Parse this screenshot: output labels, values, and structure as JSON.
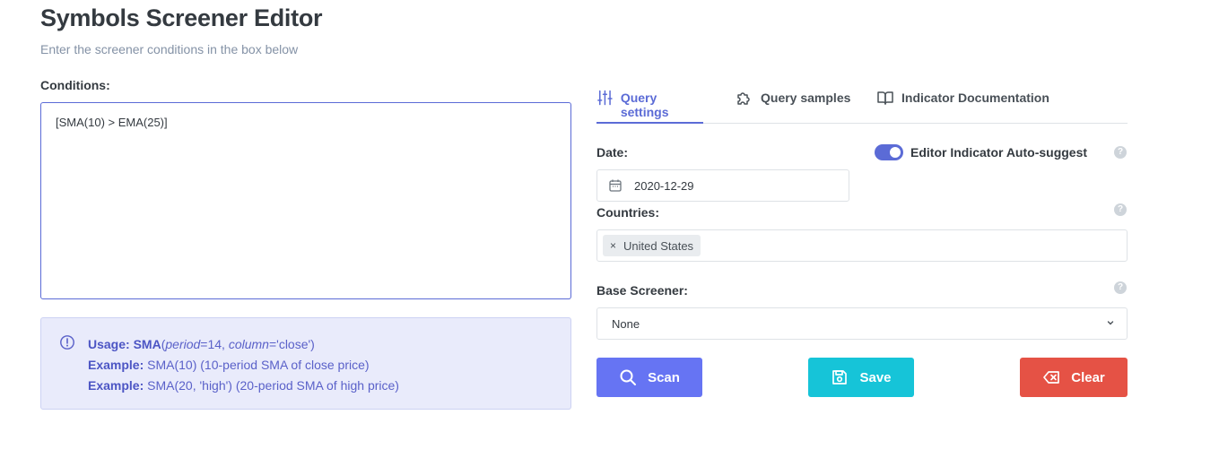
{
  "header": {
    "title": "Symbols Screener Editor",
    "subtitle": "Enter the screener conditions in the box below"
  },
  "editor": {
    "label": "Conditions:",
    "value": "[SMA(10) > EMA(25)]"
  },
  "usage": {
    "usage_label": "Usage:",
    "func_name": "SMA",
    "open_paren": "(",
    "param1": "period",
    "param1_value": "=14, ",
    "param2": "column",
    "param2_value": "='close')",
    "example_label": "Example:",
    "example1": "SMA(10) (10-period SMA of close price)",
    "example2": "SMA(20, 'high') (20-period SMA of high price)"
  },
  "tabs": [
    {
      "label": "Query settings",
      "icon": "sliders-icon",
      "active": true
    },
    {
      "label": "Query samples",
      "icon": "puzzle-icon",
      "active": false
    },
    {
      "label": "Indicator Documentation",
      "icon": "book-icon",
      "active": false
    }
  ],
  "settings": {
    "date_label": "Date:",
    "date_value": "2020-12-29",
    "autosuggest_label": "Editor Indicator Auto-suggest",
    "autosuggest_on": true,
    "countries_label": "Countries:",
    "countries": [
      "United States"
    ],
    "base_screener_label": "Base Screener:",
    "base_screener_value": "None",
    "help_glyph": "?"
  },
  "actions": {
    "scan": "Scan",
    "save": "Save",
    "clear": "Clear"
  },
  "colors": {
    "accent": "#5b6bd6",
    "scan": "#6674f3",
    "save": "#16c4d8",
    "clear": "#e55245"
  }
}
